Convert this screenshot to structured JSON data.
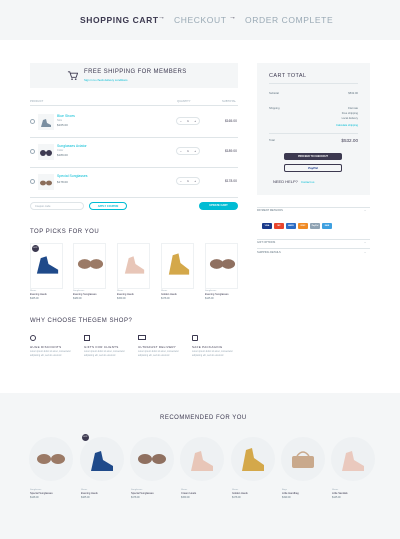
{
  "steps": {
    "cart": "SHOPPING CART",
    "checkout": "CHECKOUT",
    "complete": "ORDER COMPLETE",
    "arrow": "→"
  },
  "shipping_banner": {
    "title": "FREE SHIPPING FOR MEMBERS",
    "subtitle": "Sign in to check delivery conditions"
  },
  "table": {
    "product": "PRODUCT",
    "quantity": "QUANTITY",
    "subtotal": "SUBTOTAL"
  },
  "cart_items": [
    {
      "name": "Blue Shoes",
      "meta": "Size",
      "price": "$165.00",
      "qty": "1",
      "subtotal": "$165.00"
    },
    {
      "name": "Sunglasses Aviator",
      "meta": "Color",
      "price": "$189.00",
      "qty": "1",
      "subtotal": "$189.00"
    },
    {
      "name": "Special Sunglasses",
      "meta": "",
      "price": "$178.00",
      "qty": "1",
      "subtotal": "$178.00"
    }
  ],
  "coupon": {
    "placeholder": "Coupon code",
    "apply": "APPLY COUPON",
    "update": "UPDATE CART"
  },
  "totals": {
    "title": "CART TOTAL",
    "subtotal_label": "Subtotal",
    "subtotal_value": "$532.00",
    "shipping_label": "Shipping",
    "shipping_options": [
      "Flat rate",
      "Free shipping",
      "Local delivery"
    ],
    "calc_link": "Calculate shipping",
    "total_label": "Total",
    "total_value": "$532.00",
    "checkout": "PROCEED TO CHECKOUT",
    "paypal": "PayPal",
    "help_label": "NEED HELP?",
    "help_link": "Contact us"
  },
  "accordions": [
    "PAYMENT METHODS",
    "GIFT OPTIONS",
    "SHIPPING DETAILS"
  ],
  "payments": [
    "VISA",
    "MC",
    "AMEX",
    "DISC",
    "PayPal",
    "MAE"
  ],
  "top_picks": {
    "title": "TOP PICKS FOR YOU",
    "items": [
      {
        "cat": "Shoes",
        "name": "Evening Heels",
        "price": "$165.00"
      },
      {
        "cat": "Sunglasses",
        "name": "Evening Sunglasses",
        "price": "$189.00"
      },
      {
        "cat": "Shoes",
        "name": "Evening Heels",
        "price": "$159.00"
      },
      {
        "cat": "Shoes",
        "name": "Golden Heels",
        "price": "$178.00"
      },
      {
        "cat": "Sunglasses",
        "name": "Evening Sunglasses",
        "price": "$145.00"
      }
    ]
  },
  "why": {
    "title": "WHY CHOOSE THEGEM SHOP?",
    "items": [
      {
        "title": "HUGE DISCOUNTS",
        "text": "Lorem ipsum dolor sit amet, consectetur adipiscing elit, sed do eiusmod"
      },
      {
        "title": "GIFTS FOR CLIENTS",
        "text": "Lorem ipsum dolor sit amet, consectetur adipiscing elit, sed do eiusmod"
      },
      {
        "title": "ULTRAFAST DELIVERY",
        "text": "Lorem ipsum dolor sit amet, consectetur adipiscing elit, sed do eiusmod"
      },
      {
        "title": "SAFE PACKAGING",
        "text": "Lorem ipsum dolor sit amet, consectetur adipiscing elit, sed do eiusmod"
      }
    ]
  },
  "recommended": {
    "title": "RECOMMENDED FOR YOU",
    "items": [
      {
        "cat": "Sunglasses",
        "name": "Special Sunglasses",
        "price": "$148.00"
      },
      {
        "cat": "Shoes",
        "name": "Evening Heels",
        "price": "$165.00"
      },
      {
        "cat": "Sunglasses",
        "name": "Special Sunglasses",
        "price": "$178.00"
      },
      {
        "cat": "Shoes",
        "name": "Cream Heels",
        "price": "$159.00"
      },
      {
        "cat": "Shoes",
        "name": "Golden Heels",
        "price": "$178.00"
      },
      {
        "cat": "Bags",
        "name": "Little Handbag",
        "price": "$199.00"
      },
      {
        "cat": "Shoes",
        "name": "Little Sandals",
        "price": "$145.00"
      }
    ]
  },
  "colors": {
    "accent": "#00bcd4",
    "dark": "#3c3950"
  }
}
